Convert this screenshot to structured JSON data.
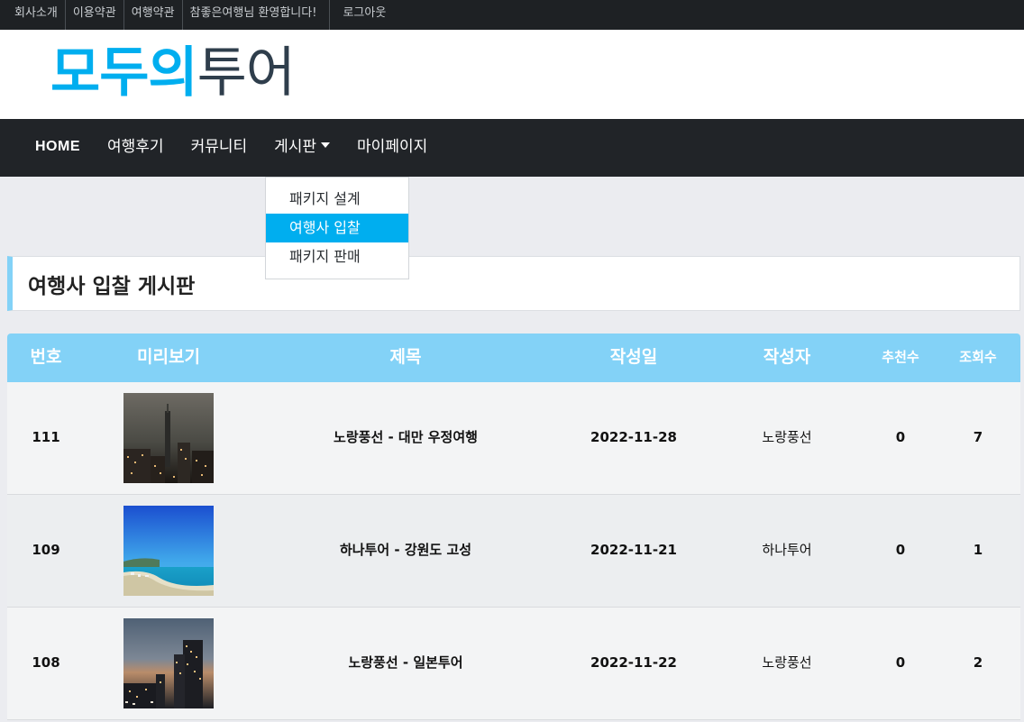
{
  "topbar": {
    "links": [
      "회사소개",
      "이용약관",
      "여행약관",
      "참좋은여행님 환영합니다!",
      "로그아웃"
    ]
  },
  "brand": {
    "logo_part1": "모두의",
    "logo_part2": "투어"
  },
  "nav": {
    "items": [
      "HOME",
      "여행후기",
      "커뮤니티",
      "게시판",
      "마이페이지"
    ]
  },
  "dropdown": {
    "items": [
      "패키지 설계",
      "여행사 입찰",
      "패키지 판매"
    ],
    "active": "여행사 입찰"
  },
  "board": {
    "title": "여행사 입찰 게시판"
  },
  "table": {
    "headers": [
      "번호",
      "미리보기",
      "제목",
      "작성일",
      "작성자",
      "추천수",
      "조회수"
    ],
    "rows": [
      {
        "num": "111",
        "title": "노랑풍선 - 대만 우정여행",
        "date": "2022-11-28",
        "author": "노랑풍선",
        "recommend": "0",
        "views": "7",
        "thumb": "night-city-tower"
      },
      {
        "num": "109",
        "title": "하나투어 - 강원도 고성",
        "date": "2022-11-21",
        "author": "하나투어",
        "recommend": "0",
        "views": "1",
        "thumb": "coastal-beach"
      },
      {
        "num": "108",
        "title": "노랑풍선 - 일본투어",
        "date": "2022-11-22",
        "author": "노랑풍선",
        "recommend": "0",
        "views": "2",
        "thumb": "harbor-dusk"
      }
    ]
  },
  "colors": {
    "accent": "#00aeef",
    "table_header": "#83d2f7",
    "nav_bg": "#212428",
    "topbar_bg": "#1e2124"
  }
}
